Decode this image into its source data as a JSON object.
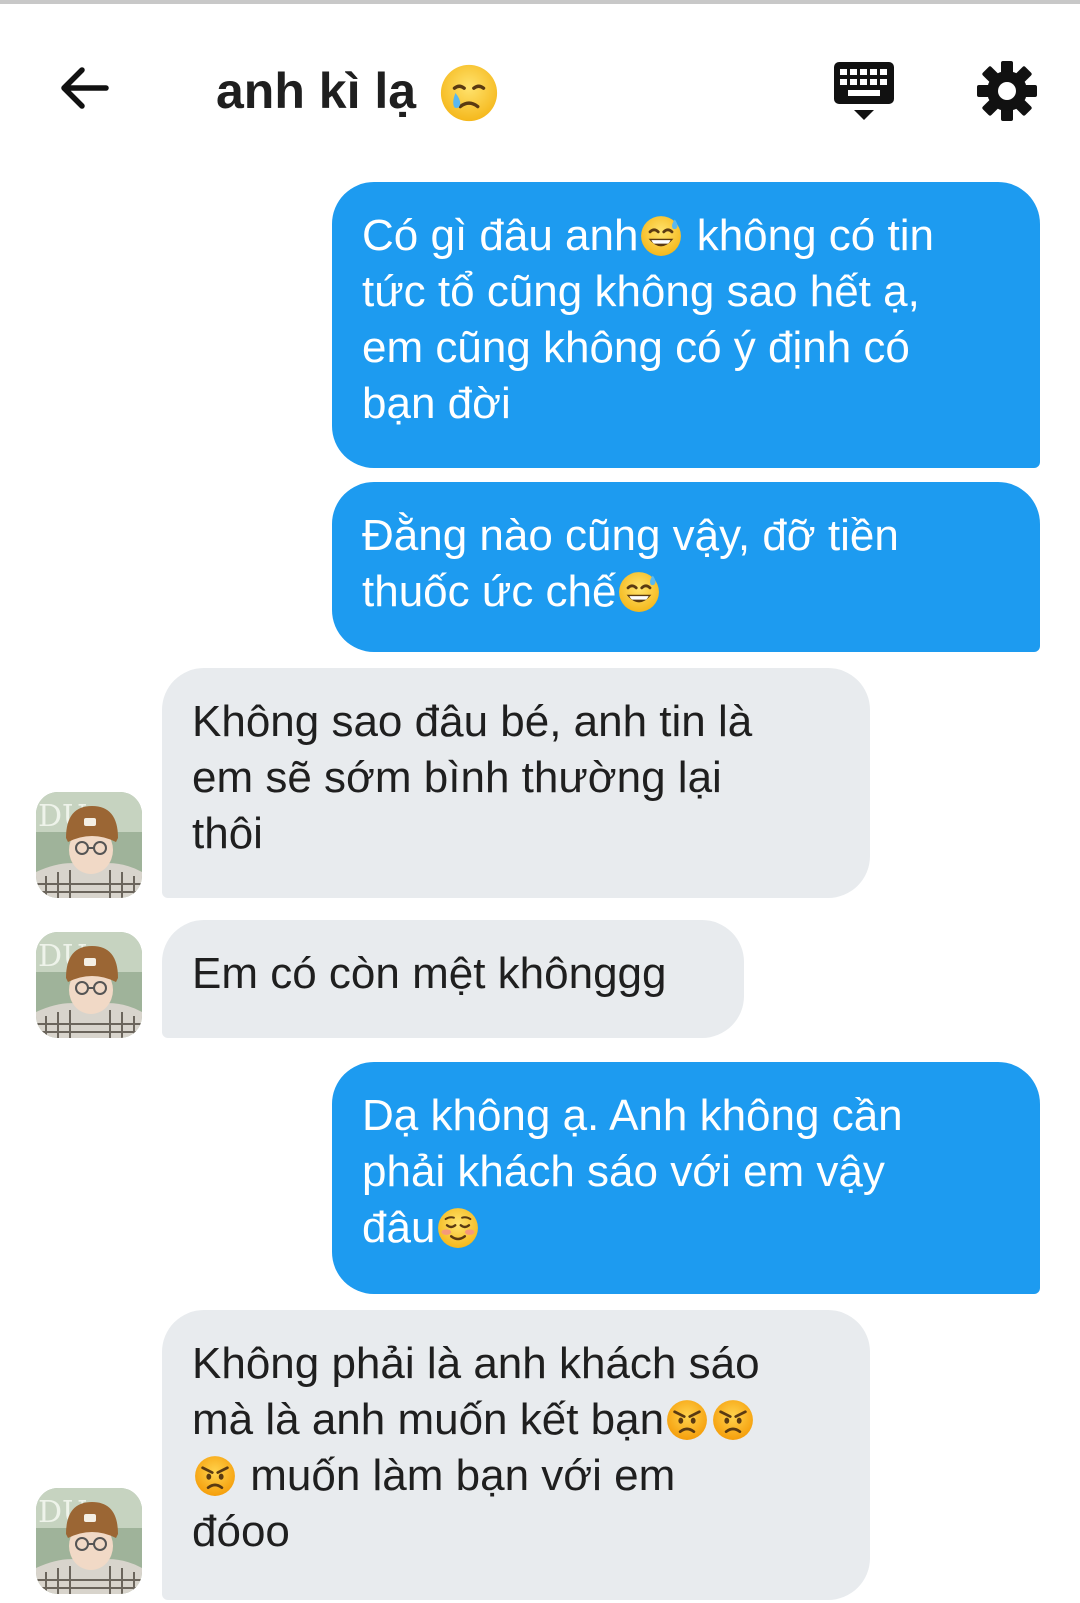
{
  "header": {
    "contact_name": "anh kì lạ",
    "title_emoji": "crying-face-emoji"
  },
  "icons": {
    "back": "arrow-left-icon",
    "keyboard": "keyboard-icon",
    "settings": "gear-icon"
  },
  "colors": {
    "sent_bubble": "#1d9bf0",
    "received_bubble": "#e8ebee",
    "text_dark": "#1f1f1f"
  },
  "messages": [
    {
      "direction": "sent",
      "lines": [
        "Có gì đâu anh",
        "không có tin",
        "tức tổ cũng không sao hết ạ,",
        "em cũng không có ý định có",
        "bạn đời"
      ]
    },
    {
      "direction": "sent",
      "lines": [
        "Đằng nào cũng vậy, đỡ tiền",
        "thuốc ức chế"
      ]
    },
    {
      "direction": "received",
      "lines": [
        "Không sao đâu bé, anh tin là",
        "em sẽ sớm bình thường lại",
        "thôi"
      ]
    },
    {
      "direction": "received",
      "lines": [
        "Em có còn mệt khônggg"
      ]
    },
    {
      "direction": "sent",
      "lines": [
        "Dạ không ạ. Anh không cần",
        "phải khách sáo với em vậy",
        "đâu"
      ]
    },
    {
      "direction": "received",
      "lines": [
        "Không phải là anh khách sáo",
        "mà là anh muốn kết bạn",
        "muốn làm bạn với em",
        "đóoo"
      ]
    }
  ]
}
